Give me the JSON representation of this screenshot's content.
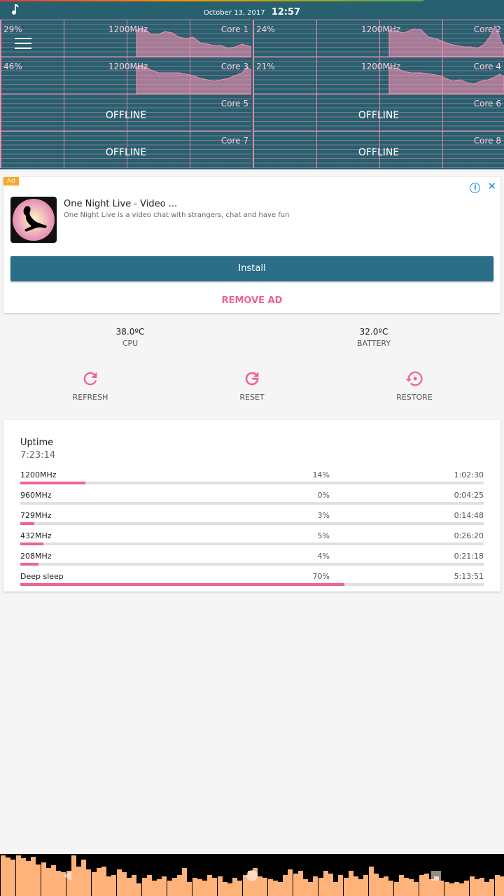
{
  "status_bar": {
    "date": "October 13, 2017",
    "time": "12:57"
  },
  "cores": [
    {
      "name": "Core 1",
      "load": "29%",
      "freq": "1200MHz",
      "online": true
    },
    {
      "name": "Core 2",
      "load": "24%",
      "freq": "1200MHz",
      "online": true
    },
    {
      "name": "Core 3",
      "load": "46%",
      "freq": "1200MHz",
      "online": true
    },
    {
      "name": "Core 4",
      "load": "21%",
      "freq": "1200MHz",
      "online": true
    },
    {
      "name": "Core 5",
      "status": "OFFLINE",
      "online": false
    },
    {
      "name": "Core 6",
      "status": "OFFLINE",
      "online": false
    },
    {
      "name": "Core 7",
      "status": "OFFLINE",
      "online": false
    },
    {
      "name": "Core 8",
      "status": "OFFLINE",
      "online": false
    }
  ],
  "ad": {
    "badge": "Ad",
    "title": "One Night Live - Video ...",
    "description": "One Night Live is a video chat with strangers, chat and have fun",
    "install_label": "Install",
    "remove_label": "REMOVE AD"
  },
  "temps": {
    "cpu": {
      "value": "38.0ºC",
      "label": "CPU"
    },
    "battery": {
      "value": "32.0ºC",
      "label": "BATTERY"
    }
  },
  "actions": {
    "refresh": "REFRESH",
    "reset": "RESET",
    "restore": "RESTORE"
  },
  "uptime": {
    "title": "Uptime",
    "value": "7:23:14",
    "states": [
      {
        "freq": "1200MHz",
        "percent": "14%",
        "time": "1:02:30",
        "fraction": 0.14
      },
      {
        "freq": "960MHz",
        "percent": "0%",
        "time": "0:04:25",
        "fraction": 0.0
      },
      {
        "freq": "729MHz",
        "percent": "3%",
        "time": "0:14:48",
        "fraction": 0.03
      },
      {
        "freq": "432MHz",
        "percent": "5%",
        "time": "0:26:20",
        "fraction": 0.05
      },
      {
        "freq": "208MHz",
        "percent": "4%",
        "time": "0:21:18",
        "fraction": 0.04
      },
      {
        "freq": "Deep sleep",
        "percent": "70%",
        "time": "5:13:51",
        "fraction": 0.7
      }
    ]
  },
  "colors": {
    "header": "#27606f",
    "accent": "#f06292",
    "install": "#2a6e87"
  }
}
